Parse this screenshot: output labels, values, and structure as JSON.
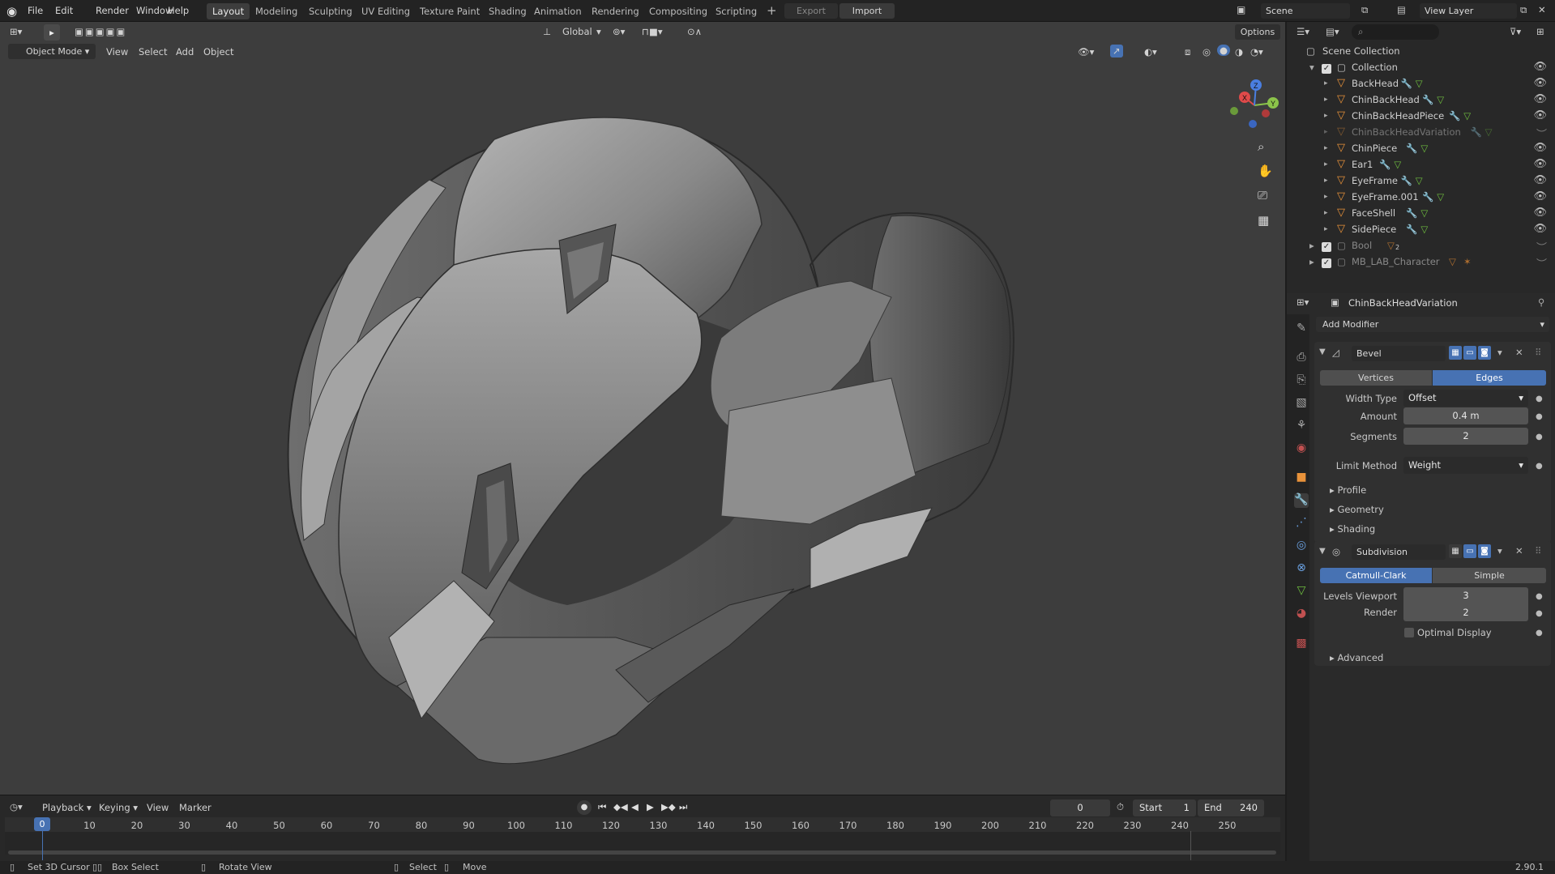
{
  "menu": [
    "File",
    "Edit",
    "Render",
    "Window",
    "Help"
  ],
  "workspaces": [
    "Layout",
    "Modeling",
    "Sculpting",
    "UV Editing",
    "Texture Paint",
    "Shading",
    "Animation",
    "Rendering",
    "Compositing",
    "Scripting"
  ],
  "active_workspace": "Layout",
  "topbar": {
    "export_label": "Export",
    "import_label": "Import",
    "scene_label": "Scene",
    "view_layer_label": "View Layer"
  },
  "viewport_header": {
    "mode": "Object Mode",
    "view": "View",
    "select": "Select",
    "add": "Add",
    "object": "Object",
    "orientation": "Global",
    "options": "Options"
  },
  "gizmo": {
    "x": "X",
    "y": "Y",
    "z": "Z"
  },
  "outliner": {
    "root": "Scene Collection",
    "collection": "Collection",
    "objects": [
      {
        "name": "BackHead",
        "visible": true
      },
      {
        "name": "ChinBackHead",
        "visible": true
      },
      {
        "name": "ChinBackHeadPiece",
        "visible": true
      },
      {
        "name": "ChinBackHeadVariation",
        "visible": false
      },
      {
        "name": "ChinPiece",
        "visible": true
      },
      {
        "name": "Ear1",
        "visible": true
      },
      {
        "name": "EyeFrame",
        "visible": true
      },
      {
        "name": "EyeFrame.001",
        "visible": true
      },
      {
        "name": "FaceShell",
        "visible": true
      },
      {
        "name": "SidePiece",
        "visible": true
      }
    ],
    "other_collections": [
      {
        "name": "Bool",
        "badge": "2"
      },
      {
        "name": "MB_LAB_Character"
      }
    ]
  },
  "properties": {
    "object_name": "ChinBackHeadVariation",
    "add_modifier": "Add Modifier",
    "bevel": {
      "name": "Bevel",
      "tabs": [
        "Vertices",
        "Edges"
      ],
      "active_tab": "Edges",
      "width_type_label": "Width Type",
      "width_type": "Offset",
      "amount_label": "Amount",
      "amount": "0.4 m",
      "segments_label": "Segments",
      "segments": "2",
      "limit_method_label": "Limit Method",
      "limit_method": "Weight",
      "sections": [
        "Profile",
        "Geometry",
        "Shading"
      ]
    },
    "subdivision": {
      "name": "Subdivision",
      "tabs": [
        "Catmull-Clark",
        "Simple"
      ],
      "active_tab": "Catmull-Clark",
      "levels_viewport_label": "Levels Viewport",
      "levels_viewport": "3",
      "render_label": "Render",
      "render": "2",
      "optimal_display_label": "Optimal Display",
      "advanced": "Advanced"
    }
  },
  "timeline": {
    "playback": "Playback",
    "keying": "Keying",
    "view": "View",
    "marker": "Marker",
    "current_frame": "0",
    "start_label": "Start",
    "start": "1",
    "end_label": "End",
    "end": "240",
    "ticks": [
      "0",
      "10",
      "20",
      "30",
      "40",
      "50",
      "60",
      "70",
      "80",
      "90",
      "100",
      "110",
      "120",
      "130",
      "140",
      "150",
      "160",
      "170",
      "180",
      "190",
      "200",
      "210",
      "220",
      "230",
      "240",
      "250"
    ]
  },
  "statusbar": {
    "set_cursor": "Set 3D Cursor",
    "box_select": "Box Select",
    "rotate_view": "Rotate View",
    "select": "Select",
    "move": "Move",
    "version": "2.90.1"
  },
  "colors": {
    "accent": "#4772b3",
    "object_orange": "#e8923a",
    "mesh_green": "#6fbf3f",
    "viewport_bg": "#3d3d3d"
  }
}
